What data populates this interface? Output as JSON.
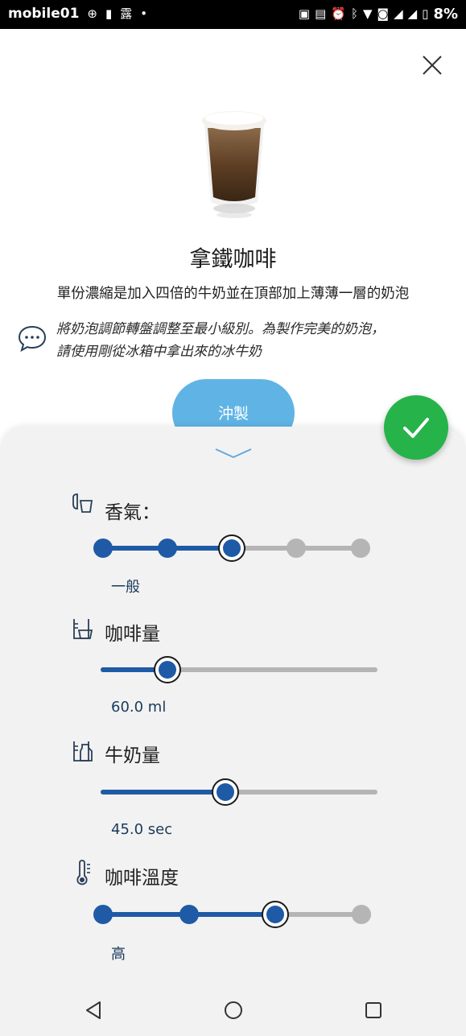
{
  "status_bar": {
    "logo": "mobile01",
    "battery_percent": "8%",
    "icons": [
      "photo-icon",
      "auto-icon",
      "alarm-icon",
      "bluetooth-icon",
      "wifi-icon",
      "volte-icon",
      "signal-icon",
      "signal-icon-2",
      "battery-icon"
    ]
  },
  "drink": {
    "name": "拿鐵咖啡",
    "description": "單份濃縮是加入四倍的牛奶並在頂部加上薄薄一層的奶泡",
    "tip_line1": "將奶泡調節轉盤調整至最小級別。為製作完美的奶泡，",
    "tip_line2": "請使用剛從冰箱中拿出來的冰牛奶",
    "brew_label": "沖製"
  },
  "settings": {
    "aroma": {
      "label": "香氣：",
      "value": "一般",
      "level": 3,
      "steps": 5
    },
    "coffee_amount": {
      "label": "咖啡量",
      "value": "60.0 ml",
      "fraction": 0.24
    },
    "milk_amount": {
      "label": "牛奶量",
      "value": "45.0 sec",
      "fraction": 0.45
    },
    "temperature": {
      "label": "咖啡溫度",
      "value": "高",
      "level": 3,
      "steps": 4
    }
  },
  "colors": {
    "accent_blue": "#1f5aa6",
    "brew_button": "#5fb4e5",
    "confirm_green": "#26b34a",
    "track_gray": "#b5b5b5"
  },
  "nav": {
    "icons": [
      "back-icon",
      "home-icon",
      "recents-icon"
    ]
  }
}
